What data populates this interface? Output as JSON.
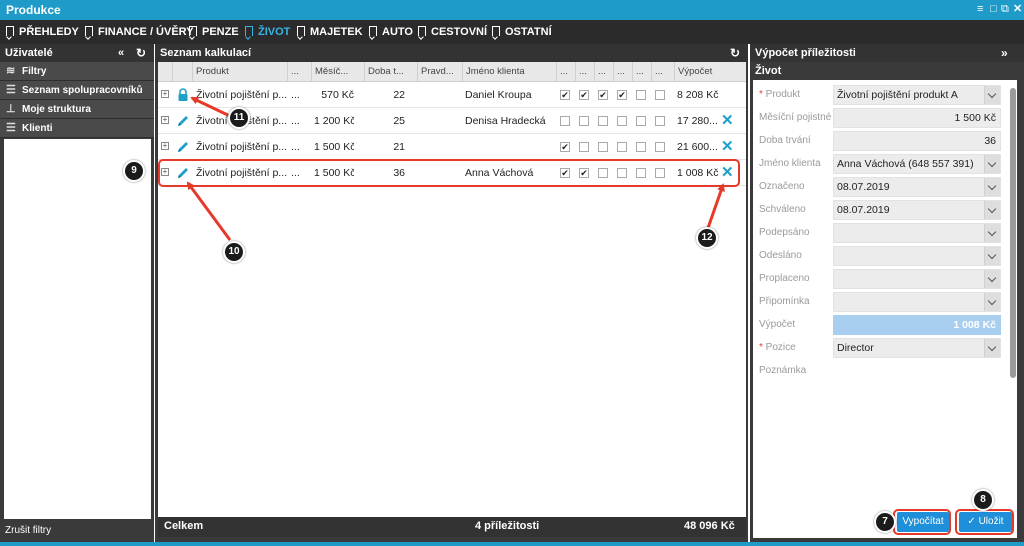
{
  "window": {
    "title": "Produkce",
    "controls": [
      "≡",
      "□",
      "⧉",
      "✕"
    ]
  },
  "nav": [
    {
      "label": "PŘEHLEDY",
      "active": false
    },
    {
      "label": "FINANCE / ÚVĚRY",
      "active": false
    },
    {
      "label": "PENZE",
      "active": false
    },
    {
      "label": "ŽIVOT",
      "active": true
    },
    {
      "label": "MAJETEK",
      "active": false
    },
    {
      "label": "AUTO",
      "active": false
    },
    {
      "label": "CESTOVNÍ",
      "active": false
    },
    {
      "label": "OSTATNÍ",
      "active": false
    }
  ],
  "left": {
    "title": "Uživatelé",
    "collapse_icon": "«",
    "refresh_icon": "↻",
    "items": [
      {
        "label": "Filtry",
        "icon": "≋"
      },
      {
        "label": "Seznam spolupracovníků",
        "icon": "☰"
      },
      {
        "label": "Moje struktura",
        "icon": "⊥"
      },
      {
        "label": "Klienti",
        "icon": "☰"
      }
    ],
    "bottom": "Zrušit filtry"
  },
  "center": {
    "title": "Seznam kalkulací",
    "refresh_icon": "↻",
    "headers": [
      "Produkt",
      "...",
      "Měsíč...",
      "Doba t...",
      "Pravd...",
      "Jméno klienta",
      "...",
      "...",
      "...",
      "...",
      "...",
      "...",
      "Výpočet"
    ],
    "rows": [
      {
        "icon": "lock",
        "product": "Životní pojištění p...",
        "dots": "...",
        "monthly": "570 Kč",
        "duration": "22",
        "prob": "",
        "client": "Daniel Kroupa",
        "checks": [
          true,
          true,
          true,
          true,
          false,
          false
        ],
        "calc": "8 208 Kč",
        "delete": false
      },
      {
        "icon": "pencil",
        "product": "Životní pojištění p...",
        "dots": "...",
        "monthly": "1 200 Kč",
        "duration": "25",
        "prob": "",
        "client": "Denisa Hradecká",
        "checks": [
          false,
          false,
          false,
          false,
          false,
          false
        ],
        "calc": "17 280...",
        "delete": true
      },
      {
        "icon": "pencil",
        "product": "Životní pojištění p...",
        "dots": "...",
        "monthly": "1 500 Kč",
        "duration": "21",
        "prob": "",
        "client": "",
        "checks": [
          true,
          false,
          false,
          false,
          false,
          false
        ],
        "calc": "21 600...",
        "delete": true
      },
      {
        "icon": "pencil",
        "product": "Životní pojištění p...",
        "dots": "...",
        "monthly": "1 500 Kč",
        "duration": "36",
        "prob": "",
        "client": "Anna Váchová",
        "checks": [
          true,
          true,
          false,
          false,
          false,
          false
        ],
        "calc": "1 008 Kč",
        "delete": true
      }
    ],
    "footer": {
      "label": "Celkem",
      "count": "4 příležitosti",
      "total": "48 096 Kč"
    }
  },
  "right": {
    "title": "Výpočet příležitosti",
    "expand_icon": "»",
    "section": "Život",
    "fields": [
      {
        "label": "Produkt",
        "required": true,
        "value": "Životní pojištění produkt A",
        "dropdown": true,
        "align": "left"
      },
      {
        "label": "Měsíční pojistné",
        "required": false,
        "value": "1 500 Kč",
        "dropdown": false,
        "align": "right"
      },
      {
        "label": "Doba trvání",
        "required": false,
        "value": "36",
        "dropdown": false,
        "align": "right"
      },
      {
        "label": "Jméno klienta",
        "required": false,
        "value": "Anna Váchová (648 557 391)",
        "dropdown": true,
        "align": "left"
      },
      {
        "label": "Označeno",
        "required": false,
        "value": "08.07.2019",
        "dropdown": true,
        "align": "left"
      },
      {
        "label": "Schváleno",
        "required": false,
        "value": "08.07.2019",
        "dropdown": true,
        "align": "left"
      },
      {
        "label": "Podepsáno",
        "required": false,
        "value": "",
        "dropdown": true,
        "align": "left"
      },
      {
        "label": "Odesláno",
        "required": false,
        "value": "",
        "dropdown": true,
        "align": "left"
      },
      {
        "label": "Proplaceno",
        "required": false,
        "value": "",
        "dropdown": true,
        "align": "left"
      },
      {
        "label": "Připomínka",
        "required": false,
        "value": "",
        "dropdown": true,
        "align": "left"
      },
      {
        "label": "Výpočet",
        "required": false,
        "value": "1 008 Kč",
        "dropdown": false,
        "align": "right",
        "highlight": true
      },
      {
        "label": "Pozice",
        "required": true,
        "value": "Director",
        "dropdown": true,
        "align": "left"
      },
      {
        "label": "Poznámka",
        "required": false,
        "value": "",
        "dropdown": false,
        "align": "left",
        "textarea": true
      }
    ],
    "buttons": {
      "calculate": "Vypočítat",
      "save": "Uložit",
      "save_icon": "✓"
    }
  },
  "callouts": [
    "7",
    "8",
    "9",
    "10",
    "11",
    "12"
  ],
  "colors": {
    "accent": "#1e9bc8",
    "active_nav": "#36b6e6",
    "callout_red": "#e53a2a",
    "button_blue": "#1e8fd8"
  }
}
